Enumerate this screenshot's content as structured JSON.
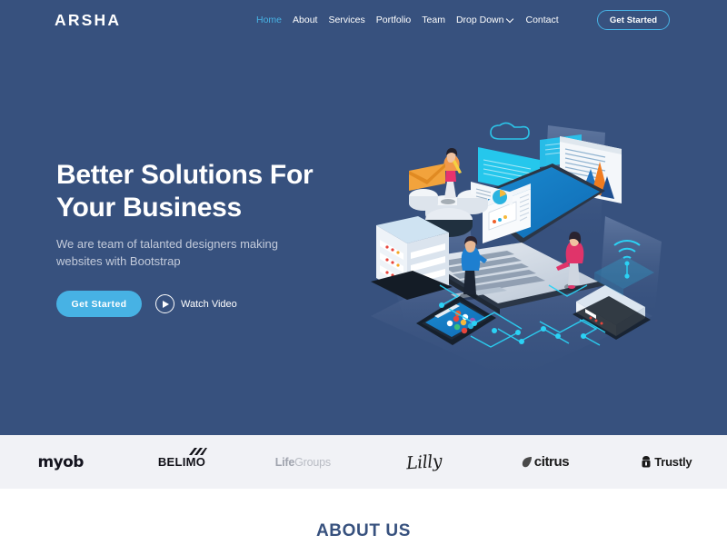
{
  "brand": {
    "name": "ARSHA"
  },
  "nav": {
    "items": [
      {
        "label": "Home",
        "active": true
      },
      {
        "label": "About",
        "active": false
      },
      {
        "label": "Services",
        "active": false
      },
      {
        "label": "Portfolio",
        "active": false
      },
      {
        "label": "Team",
        "active": false
      }
    ],
    "dropdown": {
      "label": "Drop Down",
      "icon": "chevron-down-icon"
    },
    "contact": {
      "label": "Contact"
    },
    "cta": {
      "label": "Get Started"
    }
  },
  "hero": {
    "title_line1": "Better Solutions For",
    "title_line2": "Your Business",
    "subtitle": "We are team of talanted designers making websites with Bootstrap",
    "primary_button": "Get Started",
    "video_button": "Watch Video",
    "video_icon": "play-circle-icon",
    "illustration_alt": "isometric-tech-illustration"
  },
  "clients": {
    "logos": [
      {
        "name": "myob"
      },
      {
        "name": "BELIMO"
      },
      {
        "name": "Life",
        "name2": "Groups"
      },
      {
        "name": "Lilly"
      },
      {
        "name": "citrus"
      },
      {
        "name": "Trustly"
      }
    ]
  },
  "about": {
    "title": "ABOUT US"
  },
  "colors": {
    "hero_bg": "#37517e",
    "accent": "#47b2e4",
    "clients_bg": "#f1f2f6",
    "page_bg": "#ffffff",
    "heading": "#37517e",
    "hero_sub_text": "#c3cbdb"
  }
}
